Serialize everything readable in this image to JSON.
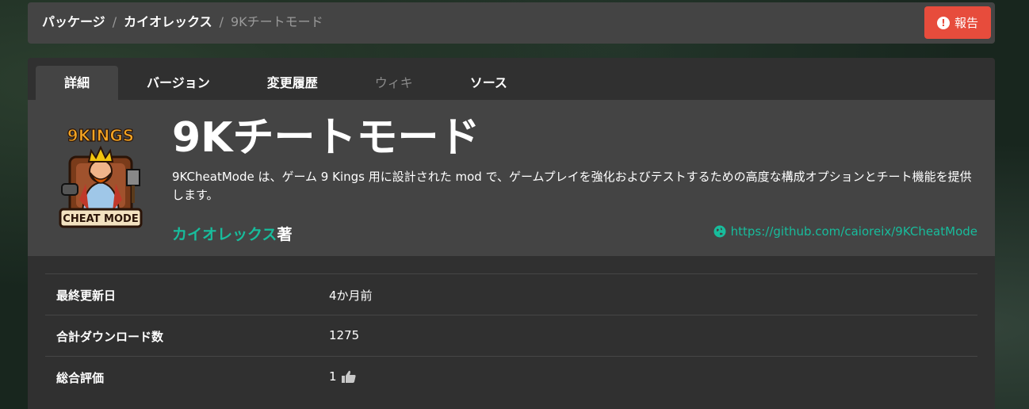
{
  "breadcrumb": {
    "items": [
      "パッケージ",
      "カイオレックス"
    ],
    "current": "9Kチートモード",
    "separator": "/"
  },
  "report_button": {
    "label": "報告",
    "icon": "exclamation-circle-icon",
    "color": "#e74c3c"
  },
  "tabs": [
    {
      "label": "詳細",
      "active": true,
      "disabled": false
    },
    {
      "label": "バージョン",
      "active": false,
      "disabled": false
    },
    {
      "label": "変更履歴",
      "active": false,
      "disabled": false
    },
    {
      "label": "ウィキ",
      "active": false,
      "disabled": true
    },
    {
      "label": "ソース",
      "active": false,
      "disabled": false
    }
  ],
  "package": {
    "title": "9Kチートモード",
    "description": "9KCheatMode は、ゲーム 9 Kings 用に設計された mod で、ゲームプレイを強化およびテストするための高度な構成オプションとチート機能を提供します。",
    "author_name": "カイオレックス",
    "author_suffix": "著",
    "repo_url": "https://github.com/caioreix/9KCheatMode",
    "logo": {
      "top_text": "9KINGS",
      "bottom_text": "CHEAT MODE"
    }
  },
  "info": [
    {
      "label": "最終更新日",
      "value": "4か月前"
    },
    {
      "label": "合計ダウンロード数",
      "value": "1275"
    },
    {
      "label": "総合評価",
      "value": "1",
      "icon": "thumbs-up-icon"
    }
  ],
  "colors": {
    "accent": "#18bc9c",
    "panel": "#303030",
    "header": "#444444",
    "danger": "#e74c3c"
  }
}
